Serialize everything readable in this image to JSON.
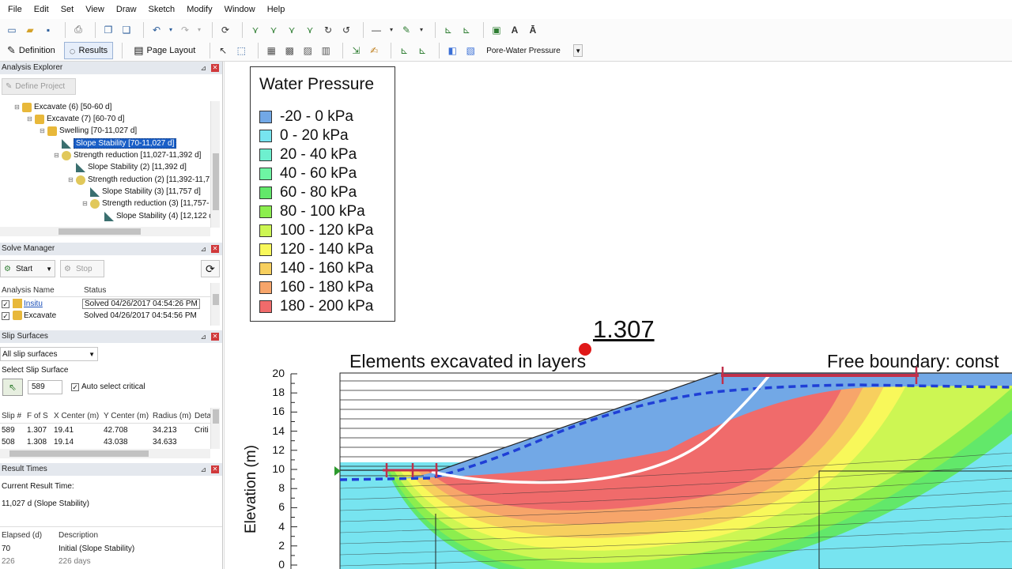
{
  "menu": [
    "File",
    "Edit",
    "Set",
    "View",
    "Draw",
    "Sketch",
    "Modify",
    "Window",
    "Help"
  ],
  "toolbar2": {
    "definition": "Definition",
    "results": "Results",
    "page_layout": "Page Layout",
    "result_type": "Pore-Water Pressure"
  },
  "analysis_explorer": {
    "title": "Analysis Explorer",
    "define_project": "Define Project",
    "tree": [
      "Excavate (6) [50-60 d]",
      "Excavate (7) [60-70 d]",
      "Swelling [70-11,027 d]",
      "Slope Stability [70-11,027 d]",
      "Strength reduction [11,027-11,392 d]",
      "Slope Stability (2) [11,392 d]",
      "Strength reduction (2) [11,392-11,7",
      "Slope Stability (3) [11,757 d]",
      "Strength reduction (3) [11,757-",
      "Slope Stability (4) [12,122 d"
    ]
  },
  "solve_manager": {
    "title": "Solve Manager",
    "start": "Start",
    "stop": "Stop",
    "col_name": "Analysis Name",
    "col_status": "Status",
    "rows": [
      {
        "name": "Insitu",
        "status": "Solved 04/26/2017 04:54:26 PM"
      },
      {
        "name": "Excavate",
        "status": "Solved 04/26/2017 04:54:56 PM"
      }
    ]
  },
  "slip_surfaces": {
    "title": "Slip Surfaces",
    "filter": "All slip surfaces",
    "select_label": "Select Slip Surface",
    "slip_value": "589",
    "auto_select": "Auto select critical",
    "columns": [
      "Slip #",
      "F of S",
      "X Center (m)",
      "Y Center (m)",
      "Radius (m)",
      "Deta"
    ],
    "rows": [
      [
        "589",
        "1.307",
        "19.41",
        "42.708",
        "34.213",
        "Criti"
      ],
      [
        "508",
        "1.308",
        "19.14",
        "43.038",
        "34.633",
        ""
      ]
    ]
  },
  "result_times": {
    "title": "Result Times",
    "current_label": "Current Result Time:",
    "current_value": "11,027 d (Slope Stability)",
    "col_elapsed": "Elapsed (d)",
    "col_desc": "Description",
    "rows": [
      [
        "70",
        "Initial (Slope Stability)"
      ],
      [
        "226",
        "226 days"
      ]
    ]
  },
  "legend": {
    "title": "Water Pressure",
    "items": [
      {
        "label": "-20 - 0 kPa",
        "color": "#72a8e6"
      },
      {
        "label": "0 - 20 kPa",
        "color": "#77e4f0"
      },
      {
        "label": "20 - 40 kPa",
        "color": "#6ef0cf"
      },
      {
        "label": "40 - 60 kPa",
        "color": "#6ef5a3"
      },
      {
        "label": "60 - 80 kPa",
        "color": "#62e86a"
      },
      {
        "label": "80 - 100 kPa",
        "color": "#8cee4e"
      },
      {
        "label": "100 - 120 kPa",
        "color": "#cdf653"
      },
      {
        "label": "120 - 140 kPa",
        "color": "#f8f85a"
      },
      {
        "label": "140 - 160 kPa",
        "color": "#f7cf5e"
      },
      {
        "label": "160 - 180 kPa",
        "color": "#f7a56a"
      },
      {
        "label": "180 - 200 kPa",
        "color": "#f06b6b"
      }
    ]
  },
  "view": {
    "factor_of_safety": "1.307",
    "annotation_left": "Elements excavated in layers",
    "annotation_right": "Free boundary: const",
    "y_axis_label": "Elevation (m)",
    "y_ticks": [
      "20",
      "18",
      "16",
      "14",
      "12",
      "10",
      "8",
      "6",
      "4",
      "2",
      "0"
    ]
  },
  "colors": {
    "accent": "#1a5fc7",
    "water_table": "#1f3fd6",
    "slip_surface": "#ffffff",
    "critical_center": "#e01818",
    "boundary_marker": "#c0304a"
  }
}
